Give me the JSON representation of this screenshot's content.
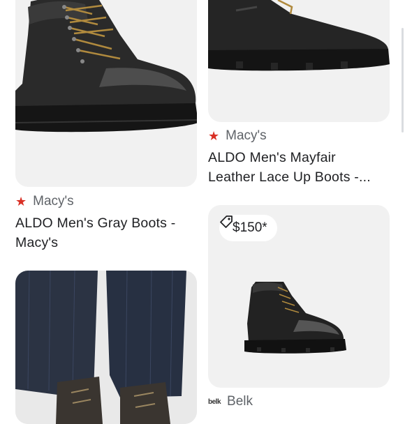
{
  "results": [
    {
      "source": "Macy's",
      "title_line1": "ALDO Men's Gray Boots -",
      "title_line2": "Macy's",
      "image_icon": "black-lace-up-boot-image"
    },
    {
      "source": "Macy's",
      "title_line1": "ALDO Men's Mayfair",
      "title_line2": "Leather Lace Up Boots -...",
      "image_icon": "black-boot-sole-image"
    },
    {
      "image_icon": "jeans-and-boots-image"
    },
    {
      "price": "$150*",
      "price_icon": "price-tag-icon",
      "source": "Belk",
      "source_logo": "belk",
      "image_icon": "black-boot-thumbnail-image"
    }
  ],
  "colors": {
    "star": "#d93025",
    "card_bg": "#f1f1f1",
    "denim": "#2b3343"
  }
}
